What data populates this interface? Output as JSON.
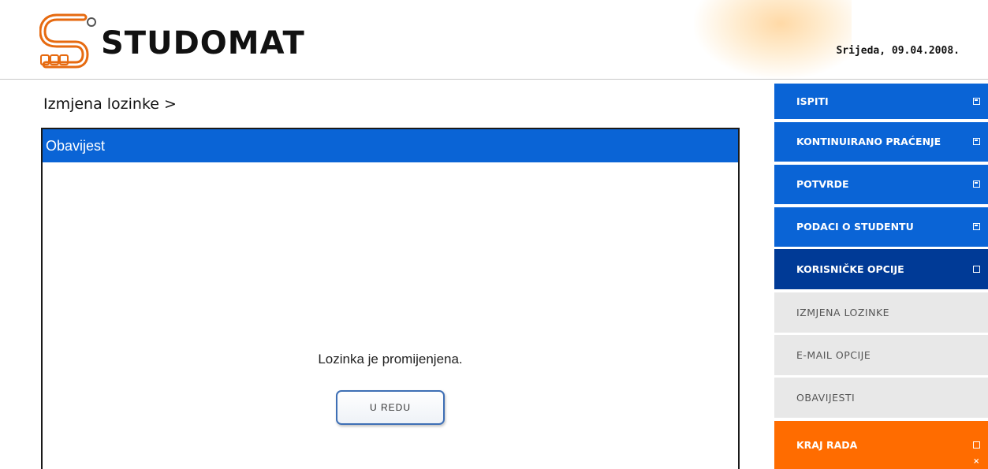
{
  "header": {
    "logo_text": "STUDOMAT",
    "date": "Srijeda, 09.04.2008."
  },
  "main": {
    "breadcrumb": "Izmjena lozinke >",
    "panel_title": "Obavijest",
    "message": "Lozinka je promijenjena.",
    "ok_label": "U REDU"
  },
  "sidebar": {
    "items": [
      {
        "label": "ISPITI",
        "icon": "expand-icon"
      },
      {
        "label": "KONTINUIRANO PRAĆENJE",
        "icon": "expand-icon"
      },
      {
        "label": "POTVRDE",
        "icon": "expand-icon"
      },
      {
        "label": "PODACI O STUDENTU",
        "icon": "expand-icon"
      },
      {
        "label": "KORISNIČKE OPCIJE",
        "icon": "collapse-icon"
      },
      {
        "label": "IZMJENA LOZINKE"
      },
      {
        "label": "E-MAIL OPCIJE"
      },
      {
        "label": "OBAVIJESTI"
      },
      {
        "label": "KRAJ RADA",
        "icon": "exit-icon"
      }
    ]
  },
  "colors": {
    "brand_blue": "#0a64d6",
    "active_blue": "#003a96",
    "submenu_grey": "#e8e8e8",
    "exit_orange": "#ff6c00"
  }
}
